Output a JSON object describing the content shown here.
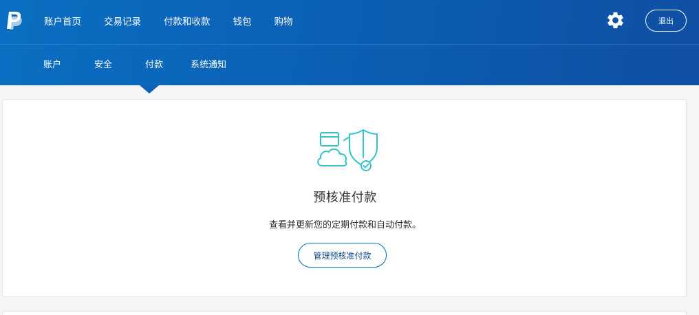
{
  "nav": {
    "items": [
      "账户首页",
      "交易记录",
      "付款和收款",
      "钱包",
      "购物"
    ],
    "logout": "退出"
  },
  "subnav": {
    "items": [
      "账户",
      "安全",
      "付款",
      "系统通知"
    ],
    "active": "付款"
  },
  "card": {
    "title": "预核准付款",
    "description": "查看并更新您的定期付款和自动付款。",
    "button": "管理预核准付款"
  },
  "icons": {
    "logo": "paypal-logo-icon",
    "settings": "gear-icon",
    "illustration": "cloud-card-shield-icon"
  },
  "colors": {
    "header": "#0b5fb4",
    "accent": "#0070ba",
    "illustration": "#36c2c7"
  }
}
